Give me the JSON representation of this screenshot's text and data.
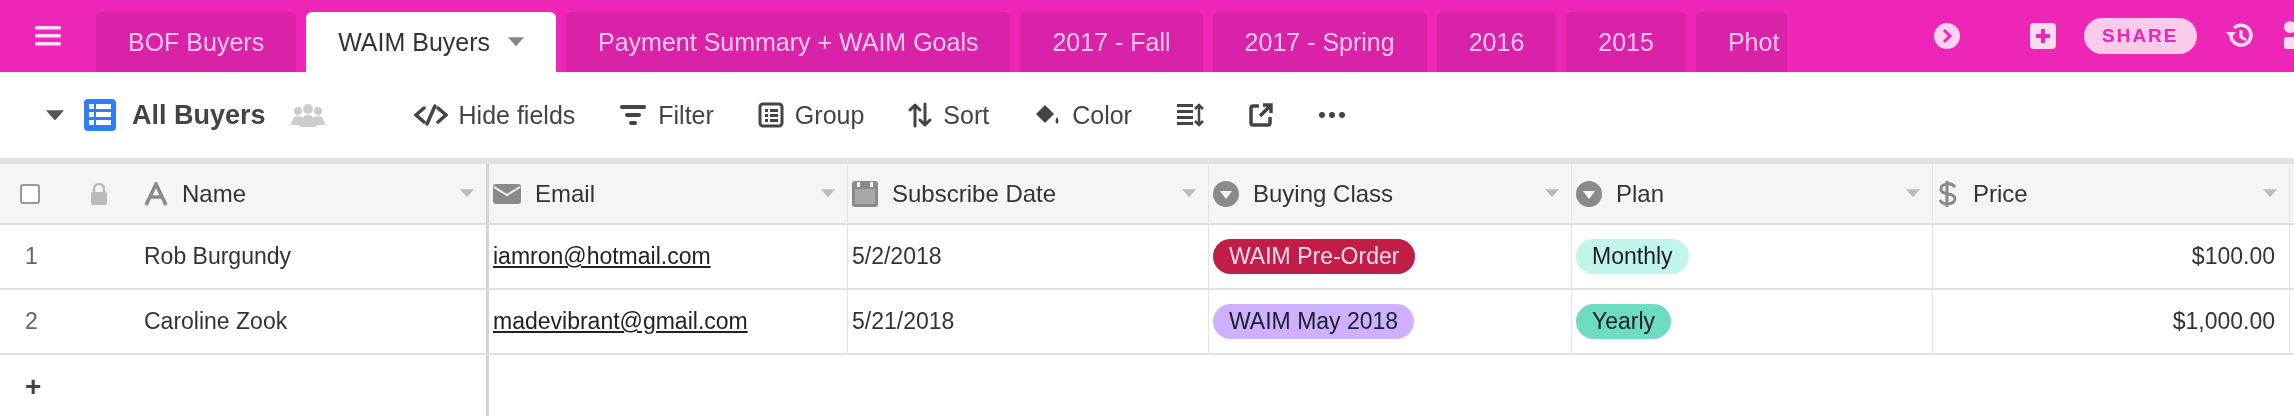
{
  "tabs": [
    {
      "label": "BOF Buyers",
      "selected": false
    },
    {
      "label": "WAIM Buyers",
      "selected": true
    },
    {
      "label": "Payment Summary + WAIM Goals",
      "selected": false
    },
    {
      "label": "2017 - Fall",
      "selected": false
    },
    {
      "label": "2017 - Spring",
      "selected": false
    },
    {
      "label": "2016",
      "selected": false
    },
    {
      "label": "2015",
      "selected": false
    },
    {
      "label": "Phot",
      "selected": false
    }
  ],
  "share_button": "SHARE",
  "toolbar": {
    "view_name": "All Buyers",
    "buttons": [
      {
        "kind": "hide",
        "label": "Hide fields"
      },
      {
        "kind": "filter",
        "label": "Filter"
      },
      {
        "kind": "group",
        "label": "Group"
      },
      {
        "kind": "sort",
        "label": "Sort"
      },
      {
        "kind": "color",
        "label": "Color"
      },
      {
        "kind": "height"
      },
      {
        "kind": "share"
      },
      {
        "kind": "more"
      }
    ]
  },
  "table": {
    "select_all": {
      "checked": false
    },
    "columns": [
      {
        "name": "Name",
        "kind": "text"
      },
      {
        "name": "Email",
        "kind": "email"
      },
      {
        "name": "Subscribe Date",
        "kind": "date"
      },
      {
        "name": "Buying Class",
        "kind": "select"
      },
      {
        "name": "Plan",
        "kind": "select"
      },
      {
        "name": "Price",
        "kind": "currency"
      }
    ],
    "rows": [
      {
        "number": "1",
        "cells": [
          "Rob Burgundy",
          "iamron@hotmail.com",
          "5/2/2018",
          {
            "label": "WAIM Pre-Order",
            "color": "#c21d49"
          },
          {
            "label": "Monthly",
            "color": "#c2f5e9"
          },
          "$100.00"
        ]
      },
      {
        "number": "2",
        "cells": [
          "Caroline Zook",
          "madevibrant@gmail.com",
          "5/21/2018",
          {
            "label": "WAIM May 2018",
            "color": "#cdb0ff"
          },
          {
            "label": "Yearly",
            "color": "#6edcc1"
          },
          "$1,000.00"
        ]
      }
    ],
    "add_row": "+"
  }
}
